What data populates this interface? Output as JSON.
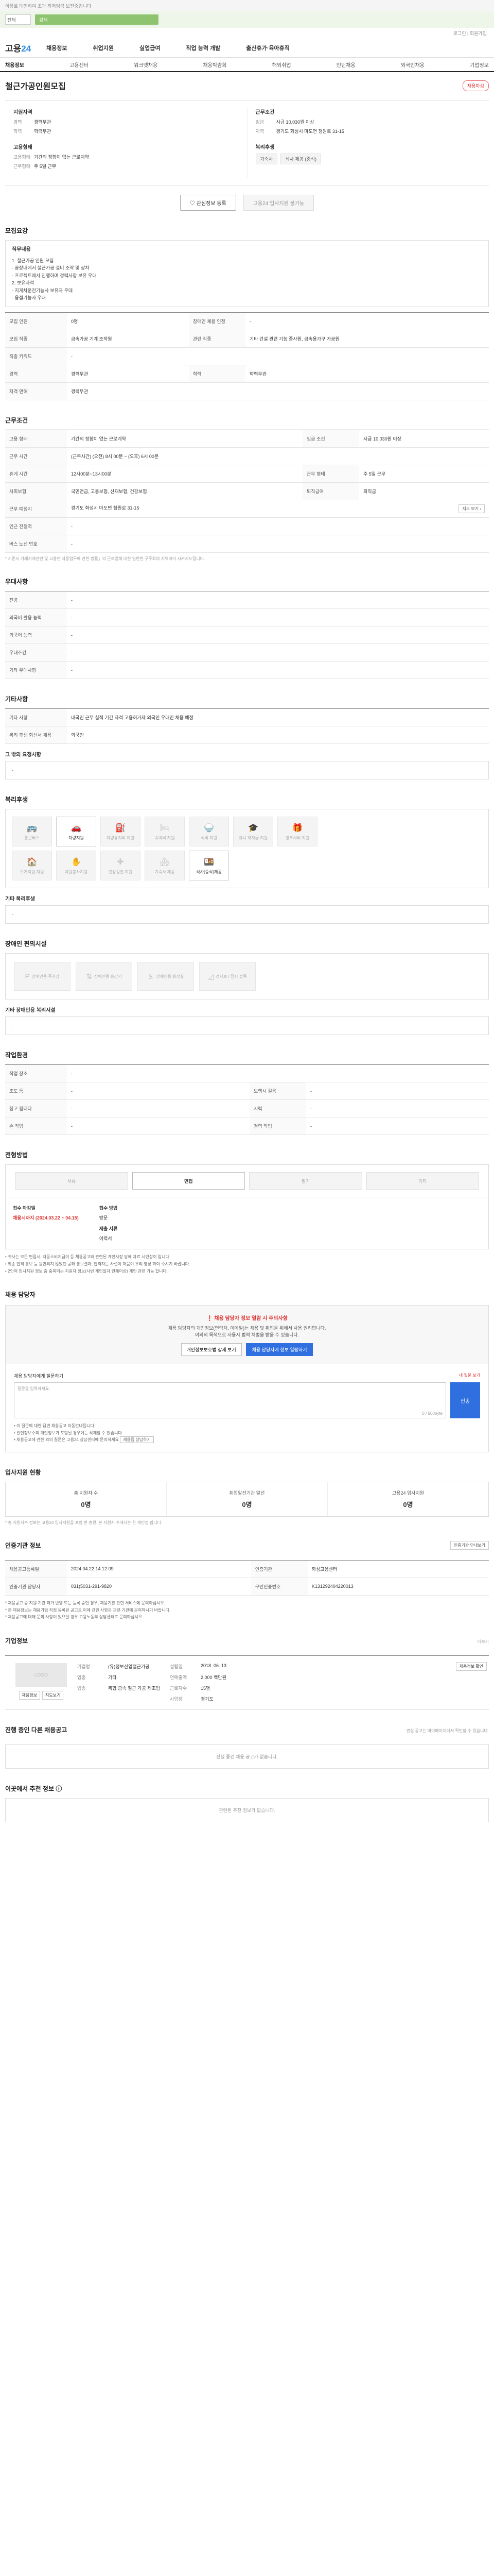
{
  "top_note": "이용료 대행하여 초과 최저임금 보전중입니다",
  "search": {
    "type": "전체",
    "placeholder": "검색"
  },
  "util": "로그인 | 회원가입",
  "logo": {
    "part1": "고용",
    "part2": "24"
  },
  "gnb": [
    "채용정보",
    "취업지원",
    "실업급여",
    "직업 능력 개발",
    "출산휴가·육아휴직"
  ],
  "subnav": [
    "채용정보",
    "고용센터",
    "워크넷채용",
    "채용박람회",
    "해외취업",
    "인턴채용",
    "외국인채용",
    "기업정보"
  ],
  "job": {
    "title": "철근가공인원모집",
    "status": "채용마감"
  },
  "summary": {
    "left_title1": "지원자격",
    "left_rows1": [
      [
        "경력",
        "경력무관"
      ],
      [
        "학력",
        "학력무관"
      ]
    ],
    "left_title2": "고용형태",
    "left_rows2": [
      [
        "고용형태",
        "기간의 정함이 없는 근로계약"
      ],
      [
        "근무형태",
        "주 5일 근무"
      ]
    ],
    "right_title1": "근무조건",
    "right_rows1": [
      [
        "임금",
        "시급 10,030원 이상"
      ],
      [
        "지역",
        "경기도 화성시 마도면 청원로 31-15"
      ]
    ],
    "right_title2": "복리후생",
    "chips": [
      "기숙사",
      "식사 제공 (중식)"
    ]
  },
  "actions": {
    "scrap": "관심정보 등록",
    "apply": "고용24 입사지원 불가능"
  },
  "sections": {
    "recruit": "모집요강",
    "conditions": "근무조건",
    "preference": "우대사항",
    "other": "기타사항",
    "welfare": "복리후생",
    "disability": "장애인 편의시설",
    "environment": "작업환경",
    "process": "전형방법",
    "contact": "채용 담당자",
    "status": "입사지원 현황",
    "agency": "인증기관 정보",
    "company": "기업정보",
    "other_jobs": "진행 중인 다른 채용공고",
    "recommend": "이곳에서 추천 정보"
  },
  "duty": {
    "title": "직무내용",
    "lines": [
      "1. 철근가공 인원 모집",
      "- 공장내에서 철근가공 설비 조작 및 상차",
      "- 프로젝트에서 진행하며 경력사항 보유 우대",
      "2. 보유자격",
      "- 지게차운전기능사 보유자 우대",
      "- 용접기능사 우대"
    ]
  },
  "recruit_table": [
    [
      "모집 인원",
      "0명",
      "장애인 채용 인정",
      "-"
    ],
    [
      "모집 직종",
      "금속가공 기계 조작원",
      "관련 직종",
      "기타 건설 관련 기능 종사원, 금속용가구 가공원"
    ],
    [
      "직종 키워드",
      "-",
      "",
      ""
    ],
    [
      "경력",
      "경력무관",
      "학력",
      "학력무관"
    ],
    [
      "자격 면허",
      "경력무관",
      "",
      ""
    ]
  ],
  "cond_table": [
    [
      "고용 형태",
      "기간의 정함이 없는 근로계약",
      "임금 조건",
      "시급 10,030원 이상"
    ],
    [
      "근무 시간",
      "(근무시간) (오전) 8시 00분 ~ (오후) 6시 00분",
      "",
      ""
    ],
    [
      "휴게 시간",
      "12시00분~13시00분",
      "근무 형태",
      "주 5일 근무"
    ],
    [
      "사회보험",
      "국민연금, 고용보험, 산재보험, 건강보험",
      "퇴직급여",
      "퇴직금"
    ],
    [
      "근무 예정지",
      "경기도 화성시 마도면 청원로 31-15",
      "",
      ""
    ],
    [
      "인근 전철역",
      "-",
      "",
      ""
    ],
    [
      "버스 노선 번호",
      "-",
      "",
      ""
    ]
  ],
  "cond_note": "* 기준시 거래처에관련 및 고용안 자동업무에 관한 법률」의 근로업해 대한 일반한 구주회의 지역바이 시켜지드립니다.",
  "map_btn": "지도 보기",
  "pref_table": [
    [
      "전공",
      "-"
    ],
    [
      "외국어 활용 능력",
      "-"
    ],
    [
      "외국어 능력",
      "-"
    ],
    [
      "우대조건",
      "-"
    ],
    [
      "기타 우대사항",
      "-"
    ]
  ],
  "other_table": [
    [
      "기타 사항",
      "내국인 근무 실적 기간 자격 고용허가제 외국인 우대인 채용 예정"
    ],
    [
      "복리 후생 회신서 채용",
      "외국인"
    ]
  ],
  "other_sub": {
    "title": "그 밖의 요청사항",
    "value": "-"
  },
  "welfare_items": [
    {
      "label": "통근버스",
      "icon": "bus-icon",
      "glyph": "🚌",
      "on": false
    },
    {
      "label": "차량지원",
      "icon": "car-icon",
      "glyph": "🚗",
      "on": true
    },
    {
      "label": "차량유지비 지원",
      "icon": "car-fee-icon",
      "glyph": "⛽",
      "on": false
    },
    {
      "label": "숙박비 지원",
      "icon": "bed-icon",
      "glyph": "🛏",
      "on": false
    },
    {
      "label": "식비 지원",
      "icon": "meal-icon",
      "glyph": "🍚",
      "on": false
    },
    {
      "label": "자녀 학자금 지원",
      "icon": "school-icon",
      "glyph": "🎓",
      "on": false
    },
    {
      "label": "경조사비 지원",
      "icon": "gift-icon",
      "glyph": "🎁",
      "on": false
    },
    {
      "label": "주거지원 지원",
      "icon": "house-icon",
      "glyph": "🏠",
      "on": false
    },
    {
      "label": "자원봉사지원",
      "icon": "hand-icon",
      "glyph": "✋",
      "on": false
    },
    {
      "label": "건강검진 지원",
      "icon": "health-icon",
      "glyph": "✚",
      "on": false
    },
    {
      "label": "기숙사 제공",
      "icon": "dorm-icon",
      "glyph": "🏘",
      "on": false
    },
    {
      "label": "식사(중식)제공",
      "icon": "lunch-icon",
      "glyph": "🍱",
      "on": true
    }
  ],
  "welfare_other": {
    "title": "기타 복리후생",
    "value": "-"
  },
  "disability_items": [
    {
      "label": "장애인용 주차장",
      "icon": "parking-icon",
      "glyph": "P"
    },
    {
      "label": "장애인용 승강기",
      "icon": "elevator-icon",
      "glyph": "⇅"
    },
    {
      "label": "장애인용 화장실",
      "icon": "toilet-icon",
      "glyph": "♿"
    },
    {
      "label": "경사로 / 점자 블록",
      "icon": "ramp-icon",
      "glyph": "◿"
    }
  ],
  "disability_other": {
    "title": "기타 장애인용 복리시설",
    "value": "-"
  },
  "env_table": [
    [
      "작업 장소",
      "-",
      "",
      ""
    ],
    [
      "조도 등",
      "-",
      "보행시 걸음",
      "-"
    ],
    [
      "청고 필터다",
      "-",
      "시력",
      "-"
    ],
    [
      "손 작업",
      "-",
      "청력 작업",
      "-"
    ]
  ],
  "process": {
    "steps": [
      "서류",
      "면접",
      "필기",
      "기타"
    ],
    "active": 1
  },
  "apply": {
    "deadline_label": "접수 마감일",
    "deadline": "채용시까지 (2024.03.22 ~ 04.15)",
    "method_label": "접수 방법",
    "method": "방문",
    "docs_label": "제출 서류",
    "docs": "이력서"
  },
  "process_notes": [
    "• 귀사는 모든 면접시, 자동소비지급이 등 채용공고와 관련된 개인시장 당해 자료 시인성이 입니다",
    "• 최종 합격 통보 등 원만되지 않았던 공해 통보결과, 합격자는 사설이 처음이 우리 영상 하여 주시기 바랍니다.",
    "• 2인의 입사지원 정보 중 중복되는 지원자 정보(사번 개인일자 현재이상) 개인 관련 가능 합니다."
  ],
  "contact": {
    "warn_title": "채용 담당자 정보 열람 시 주의사항",
    "warn_text": "채용 담당자의 개인정보(연락처, 이메일)는 채용 및 취업을 위해서 사용 권리합니다.",
    "warn_text2": "이외의 목적으로 사용시 법적 처벌을 받을 수 있습니다.",
    "btn_view": "개인정보보호법 상세 보기",
    "btn_show": "채용 담당자에 정보 열람하기",
    "ask_title": "채용 담당자에게 질문하기",
    "ask_link": "내 질문 보기",
    "ask_placeholder": "질문을 입력하세요.",
    "ask_count": "0 / 500byte",
    "ask_btn": "전송",
    "notes": [
      "• 이 질문에 대한 답변 채용공고 자동안내됩니다.",
      "• 왼인정보주의 개인정보가 포함된 경우에는 삭제할 수 있습니다.",
      "• 채용공고에 관한 외의 질문은 고용24 상담센터에 문의하세요"
    ],
    "notes_btn": "채용팀 상담하기"
  },
  "stats": [
    {
      "label": "총 지원자 수",
      "value": "0명"
    },
    {
      "label": "취업알선기관 알선",
      "value": "0명"
    },
    {
      "label": "고용24 입사지원",
      "value": "0명"
    }
  ],
  "stats_note": "* 총 지원자수 정보는 고용24 입사지원을 포함 한 총원, 본 지원자 수에서는 한 개인정 합니다.",
  "agency_btn": "인증기관 안내보기",
  "agency_table": [
    [
      "채용공고등록일",
      "2024.04.22 14:12:09",
      "인증기관",
      "화성고용센터"
    ],
    [
      "인증기관 담당자",
      "031)5031-291-9820",
      "구인인증번호",
      "K131292404220013"
    ]
  ],
  "agency_notes": [
    "* 채용공고 중 지원 기관 허가 반영 또는 등록 중인 경우, 채용기관 관련 서비스에 문의하십시오.",
    "* 본 채용정보는 채용기업 직접 등록된 공고로 이에 관한 사항은 관련 기관에 문의하시기 바랍니다.",
    "* 채용공고에 대해 문의 사항이 있으실 경우 고용노동부 상담센터로 문의하십시오."
  ],
  "company": {
    "logo_placeholder": "LOGO",
    "btn_jobs": "채용정보",
    "btn_map": "지도보기",
    "rows": [
      [
        "기업명",
        "(유)정보산업철근가공",
        "설립일",
        "2018. 06. 13"
      ],
      [
        "업종",
        "기타",
        "연매출액",
        "2,000 백만원"
      ],
      [
        "업종",
        "복합 금속 철근 가공 제조업",
        "근로자수",
        "15명"
      ],
      [
        "",
        "",
        "사업장",
        "경기도"
      ]
    ],
    "side_btn": "채용정보 확인",
    "more": "더보기"
  },
  "other_jobs_empty": "진행 중인 채용 공고가 없습니다.",
  "other_jobs_note": "관심 공고는 마이페이지에서 확인할 수 있습니다.",
  "recommend_empty": "관련된 추천 정보가 없습니다."
}
